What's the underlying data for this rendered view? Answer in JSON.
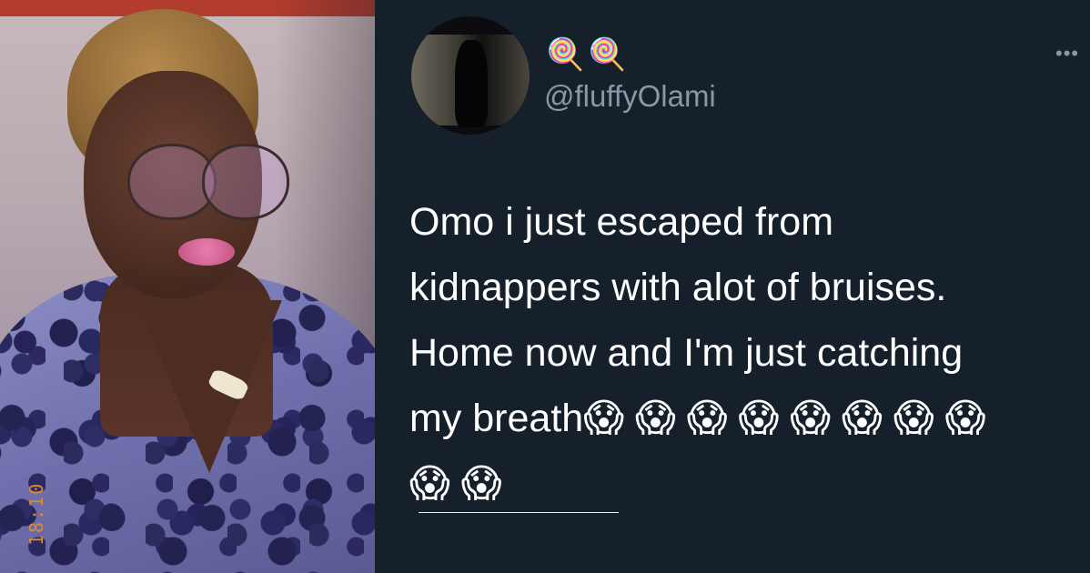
{
  "photo": {
    "timestamp_overlay": "18:10"
  },
  "tweet": {
    "display_name": "🍭🍭",
    "handle": "@fluffyOlami",
    "more_label": "•••",
    "text": "Omo i just escaped from\nkidnappers with alot of bruises.\nHome now and I'm just catching\nmy breath😱 😱 😱 😱 😱 😱 😱 😱\n😱 😱"
  },
  "colors": {
    "background": "#15202b",
    "text_primary": "#ffffff",
    "text_secondary": "#8899a6"
  }
}
